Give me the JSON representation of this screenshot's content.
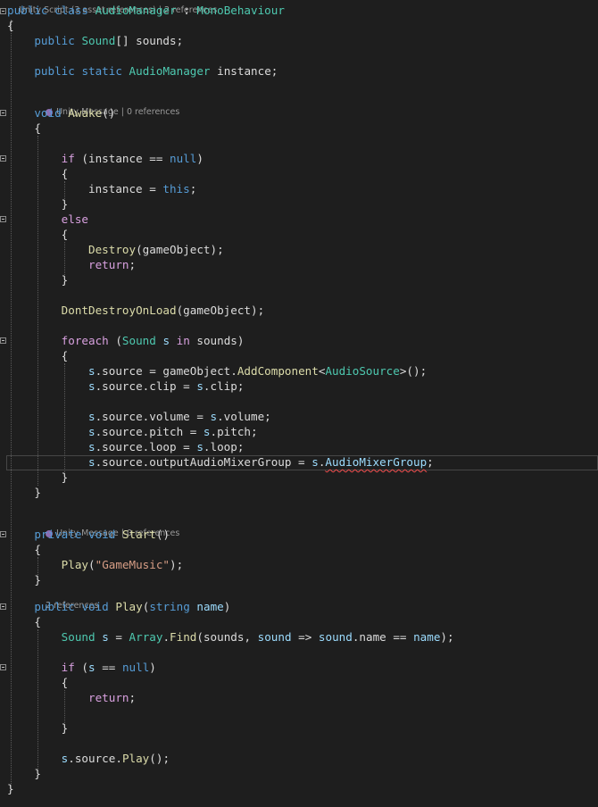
{
  "top_codelens": "Unity Script (3 asset references) | 2 references",
  "codelens": {
    "awake": "Unity Message | 0 references",
    "start": "Unity Message | 0 references",
    "play": "2 references"
  },
  "lines": [
    [
      [
        "kw",
        "public"
      ],
      [
        "plain",
        " "
      ],
      [
        "kw",
        "class"
      ],
      [
        "plain",
        " "
      ],
      [
        "ty",
        "AudioManager"
      ],
      [
        "plain",
        " : "
      ],
      [
        "ty",
        "MonoBehaviour"
      ]
    ],
    [
      [
        "plain",
        "{"
      ]
    ],
    [
      [
        "plain",
        "    "
      ],
      [
        "kw",
        "public"
      ],
      [
        "plain",
        " "
      ],
      [
        "ty",
        "Sound"
      ],
      [
        "plain",
        "[] sounds;"
      ]
    ],
    [
      [
        "plain",
        "    "
      ],
      [
        "kw",
        "public"
      ],
      [
        "plain",
        " "
      ],
      [
        "kw",
        "static"
      ],
      [
        "plain",
        " "
      ],
      [
        "ty",
        "AudioManager"
      ],
      [
        "plain",
        " instance;"
      ]
    ],
    [
      [
        "plain",
        "    "
      ],
      [
        "kw",
        "void"
      ],
      [
        "plain",
        " "
      ],
      [
        "fn",
        "Awake"
      ],
      [
        "plain",
        "()"
      ]
    ],
    [
      [
        "plain",
        "    {"
      ]
    ],
    [
      [
        "plain",
        "        "
      ],
      [
        "ctl",
        "if"
      ],
      [
        "plain",
        " (instance == "
      ],
      [
        "kw",
        "null"
      ],
      [
        "plain",
        ")"
      ]
    ],
    [
      [
        "plain",
        "        {"
      ]
    ],
    [
      [
        "plain",
        "            instance = "
      ],
      [
        "kw",
        "this"
      ],
      [
        "plain",
        ";"
      ]
    ],
    [
      [
        "plain",
        "        }"
      ]
    ],
    [
      [
        "plain",
        "        "
      ],
      [
        "ctl",
        "else"
      ]
    ],
    [
      [
        "plain",
        "        {"
      ]
    ],
    [
      [
        "plain",
        "            "
      ],
      [
        "fn",
        "Destroy"
      ],
      [
        "plain",
        "(gameObject);"
      ]
    ],
    [
      [
        "plain",
        "            "
      ],
      [
        "ctl",
        "return"
      ],
      [
        "plain",
        ";"
      ]
    ],
    [
      [
        "plain",
        "        }"
      ]
    ],
    [
      [
        "plain",
        "        "
      ],
      [
        "fn",
        "DontDestroyOnLoad"
      ],
      [
        "plain",
        "(gameObject);"
      ]
    ],
    [
      [
        "plain",
        "        "
      ],
      [
        "ctl",
        "foreach"
      ],
      [
        "plain",
        " ("
      ],
      [
        "ty",
        "Sound"
      ],
      [
        "plain",
        " "
      ],
      [
        "var",
        "s"
      ],
      [
        "plain",
        " "
      ],
      [
        "ctl",
        "in"
      ],
      [
        "plain",
        " sounds)"
      ]
    ],
    [
      [
        "plain",
        "        {"
      ]
    ],
    [
      [
        "plain",
        "            "
      ],
      [
        "var",
        "s"
      ],
      [
        "plain",
        ".source = gameObject."
      ],
      [
        "fn",
        "AddComponent"
      ],
      [
        "plain",
        "<"
      ],
      [
        "ty",
        "AudioSource"
      ],
      [
        "plain",
        ">();"
      ]
    ],
    [
      [
        "plain",
        "            "
      ],
      [
        "var",
        "s"
      ],
      [
        "plain",
        ".source.clip = "
      ],
      [
        "var",
        "s"
      ],
      [
        "plain",
        ".clip;"
      ]
    ],
    [
      [
        "plain",
        "            "
      ],
      [
        "var",
        "s"
      ],
      [
        "plain",
        ".source.volume = "
      ],
      [
        "var",
        "s"
      ],
      [
        "plain",
        ".volume;"
      ]
    ],
    [
      [
        "plain",
        "            "
      ],
      [
        "var",
        "s"
      ],
      [
        "plain",
        ".source.pitch = "
      ],
      [
        "var",
        "s"
      ],
      [
        "plain",
        ".pitch;"
      ]
    ],
    [
      [
        "plain",
        "            "
      ],
      [
        "var",
        "s"
      ],
      [
        "plain",
        ".source.loop = "
      ],
      [
        "var",
        "s"
      ],
      [
        "plain",
        ".loop;"
      ]
    ],
    [
      [
        "plain",
        "            "
      ],
      [
        "var",
        "s"
      ],
      [
        "plain",
        ".source.outputAudioMixerGroup = "
      ],
      [
        "var",
        "s"
      ],
      [
        "plain",
        "."
      ],
      [
        "err",
        "AudioMixerGroup"
      ],
      [
        "plain",
        ";"
      ]
    ],
    [
      [
        "plain",
        "        }"
      ]
    ],
    [
      [
        "plain",
        "    }"
      ]
    ],
    [
      [
        "plain",
        "    "
      ],
      [
        "kw",
        "private"
      ],
      [
        "plain",
        " "
      ],
      [
        "kw",
        "void"
      ],
      [
        "plain",
        " "
      ],
      [
        "fn",
        "Start"
      ],
      [
        "plain",
        "()"
      ]
    ],
    [
      [
        "plain",
        "    {"
      ]
    ],
    [
      [
        "plain",
        "        "
      ],
      [
        "fn",
        "Play"
      ],
      [
        "plain",
        "("
      ],
      [
        "str",
        "\"GameMusic\""
      ],
      [
        "plain",
        ");"
      ]
    ],
    [
      [
        "plain",
        "    }"
      ]
    ],
    [
      [
        "plain",
        "    "
      ],
      [
        "kw",
        "public"
      ],
      [
        "plain",
        " "
      ],
      [
        "kw",
        "void"
      ],
      [
        "plain",
        " "
      ],
      [
        "fn",
        "Play"
      ],
      [
        "plain",
        "("
      ],
      [
        "kw",
        "string"
      ],
      [
        "plain",
        " "
      ],
      [
        "var",
        "name"
      ],
      [
        "plain",
        ")"
      ]
    ],
    [
      [
        "plain",
        "    {"
      ]
    ],
    [
      [
        "plain",
        "        "
      ],
      [
        "ty",
        "Sound"
      ],
      [
        "plain",
        " "
      ],
      [
        "var",
        "s"
      ],
      [
        "plain",
        " = "
      ],
      [
        "ty",
        "Array"
      ],
      [
        "plain",
        "."
      ],
      [
        "fn",
        "Find"
      ],
      [
        "plain",
        "(sounds, "
      ],
      [
        "var",
        "sound"
      ],
      [
        "plain",
        " => "
      ],
      [
        "var",
        "sound"
      ],
      [
        "plain",
        ".name == "
      ],
      [
        "var",
        "name"
      ],
      [
        "plain",
        ");"
      ]
    ],
    [
      [
        "plain",
        "        "
      ],
      [
        "ctl",
        "if"
      ],
      [
        "plain",
        " ("
      ],
      [
        "var",
        "s"
      ],
      [
        "plain",
        " == "
      ],
      [
        "kw",
        "null"
      ],
      [
        "plain",
        ")"
      ]
    ],
    [
      [
        "plain",
        "        {"
      ]
    ],
    [
      [
        "plain",
        "            "
      ],
      [
        "ctl",
        "return"
      ],
      [
        "plain",
        ";"
      ]
    ],
    [
      [
        "plain",
        "        }"
      ]
    ],
    [
      [
        "plain",
        "        "
      ],
      [
        "var",
        "s"
      ],
      [
        "plain",
        ".source."
      ],
      [
        "fn",
        "Play"
      ],
      [
        "plain",
        "();"
      ]
    ],
    [
      [
        "plain",
        "    }"
      ]
    ],
    [
      [
        "plain",
        "}"
      ]
    ]
  ]
}
